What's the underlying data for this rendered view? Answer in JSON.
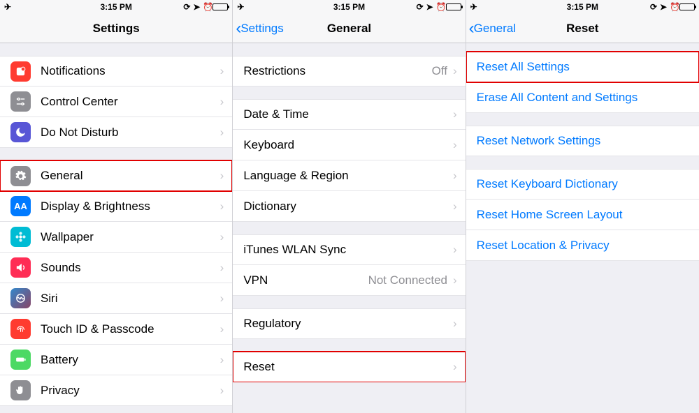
{
  "status": {
    "time": "3:15 PM"
  },
  "screen1": {
    "title": "Settings",
    "groups": [
      [
        {
          "key": "notif",
          "label": "Notifications",
          "icon": "ic-notif"
        },
        {
          "key": "cc",
          "label": "Control Center",
          "icon": "ic-cc"
        },
        {
          "key": "dnd",
          "label": "Do Not Disturb",
          "icon": "ic-dnd"
        }
      ],
      [
        {
          "key": "gen",
          "label": "General",
          "icon": "ic-gen",
          "highlight": true
        },
        {
          "key": "disp",
          "label": "Display & Brightness",
          "icon": "ic-disp"
        },
        {
          "key": "wall",
          "label": "Wallpaper",
          "icon": "ic-wall"
        },
        {
          "key": "sound",
          "label": "Sounds",
          "icon": "ic-sound"
        },
        {
          "key": "siri",
          "label": "Siri",
          "icon": "ic-siri"
        },
        {
          "key": "touch",
          "label": "Touch ID & Passcode",
          "icon": "ic-touch"
        },
        {
          "key": "batt",
          "label": "Battery",
          "icon": "ic-batt"
        },
        {
          "key": "priv",
          "label": "Privacy",
          "icon": "ic-priv"
        }
      ]
    ]
  },
  "screen2": {
    "back": "Settings",
    "title": "General",
    "groups": [
      [
        {
          "key": "restr",
          "label": "Restrictions",
          "detail": "Off"
        }
      ],
      [
        {
          "key": "dt",
          "label": "Date & Time"
        },
        {
          "key": "kb",
          "label": "Keyboard"
        },
        {
          "key": "lr",
          "label": "Language & Region"
        },
        {
          "key": "dict",
          "label": "Dictionary"
        }
      ],
      [
        {
          "key": "wlan",
          "label": "iTunes WLAN Sync"
        },
        {
          "key": "vpn",
          "label": "VPN",
          "detail": "Not Connected"
        }
      ],
      [
        {
          "key": "reg",
          "label": "Regulatory"
        }
      ],
      [
        {
          "key": "reset",
          "label": "Reset",
          "highlight": true
        }
      ]
    ]
  },
  "screen3": {
    "back": "General",
    "title": "Reset",
    "groups": [
      [
        {
          "key": "ras",
          "label": "Reset All Settings",
          "highlight": true
        },
        {
          "key": "eac",
          "label": "Erase All Content and Settings"
        }
      ],
      [
        {
          "key": "rns",
          "label": "Reset Network Settings"
        }
      ],
      [
        {
          "key": "rkd",
          "label": "Reset Keyboard Dictionary"
        },
        {
          "key": "rhs",
          "label": "Reset Home Screen Layout"
        },
        {
          "key": "rlp",
          "label": "Reset Location & Privacy"
        }
      ]
    ]
  },
  "icon_glyphs": {
    "ic-notif": "notif",
    "ic-cc": "cc",
    "ic-dnd": "moon",
    "ic-gen": "gear",
    "ic-disp": "AA",
    "ic-wall": "flower",
    "ic-sound": "speaker",
    "ic-siri": "siri",
    "ic-touch": "finger",
    "ic-batt": "batt",
    "ic-priv": "hand"
  }
}
